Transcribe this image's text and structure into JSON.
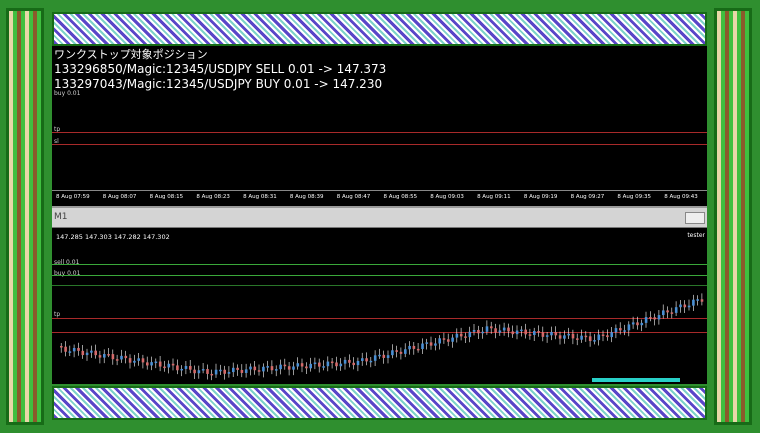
{
  "window": {
    "header_title": "ワンクストップ対象ポジション",
    "overlay_lines": [
      "133296850/Magic:12345/USDJPY SELL 0.01 -> 147.373",
      "133297043/Magic:12345/USDJPY BUY 0.01 -> 147.230"
    ],
    "upper_labels": {
      "buy": "buy 0.01",
      "tp": "tp",
      "sl": "sl"
    },
    "time_ticks": [
      "8 Aug 07:59",
      "8 Aug 08:07",
      "8 Aug 08:15",
      "8 Aug 08:23",
      "8 Aug 08:31",
      "8 Aug 08:39",
      "8 Aug 08:47",
      "8 Aug 08:55",
      "8 Aug 09:03",
      "8 Aug 09:11",
      "8 Aug 09:19",
      "8 Aug 09:27",
      "8 Aug 09:35",
      "8 Aug 09:43"
    ],
    "separator_label": "M1",
    "ohlc_text": "147.285 147.303 147.282 147.302",
    "lower_labels": {
      "sell": "sell 0.01",
      "buy": "buy 0.01",
      "tp": "tp"
    },
    "corner_tag": "tester"
  },
  "colors": {
    "bull": "#4a8fd4",
    "bear": "#d46a6a",
    "green_line": "#3aa83a",
    "red_line": "#a82a2a",
    "cyan_bar": "#28d0c8"
  },
  "icons": [
    "frame-border-left",
    "frame-border-right",
    "pattern-band-top",
    "pattern-band-bottom",
    "minimize-icon"
  ]
}
